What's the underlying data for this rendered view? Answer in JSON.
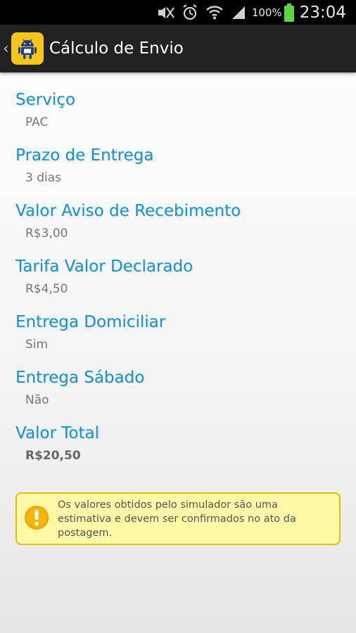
{
  "status_bar": {
    "battery_percent": "100%",
    "time": "23:04",
    "icons": [
      "mute-icon",
      "alarm-icon",
      "wifi-icon",
      "signal-icon",
      "battery-icon"
    ]
  },
  "action_bar": {
    "title": "Cálculo de Envio",
    "icon": "android-app-icon"
  },
  "fields": [
    {
      "label": "Serviço",
      "value": "PAC"
    },
    {
      "label": "Prazo de Entrega",
      "value": "3 dias"
    },
    {
      "label": "Valor Aviso de Recebimento",
      "value": "R$3,00"
    },
    {
      "label": "Tarifa Valor Declarado",
      "value": "R$4,50"
    },
    {
      "label": "Entrega Domiciliar",
      "value": "Sim"
    },
    {
      "label": "Entrega Sábado",
      "value": "Não"
    },
    {
      "label": "Valor Total",
      "value": "R$20,50"
    }
  ],
  "warning": {
    "text": "Os valores obtidos pelo simulador são uma estimativa e devem ser confirmados no ato da postagem.",
    "icon": "warning-icon"
  },
  "colors": {
    "label": "#1496c8",
    "action_bar": "#222222",
    "app_icon_bg": "#f5c517",
    "warning_bg": "#fdf8a6",
    "warning_border": "#e2c000",
    "warning_icon": "#f0a500"
  }
}
